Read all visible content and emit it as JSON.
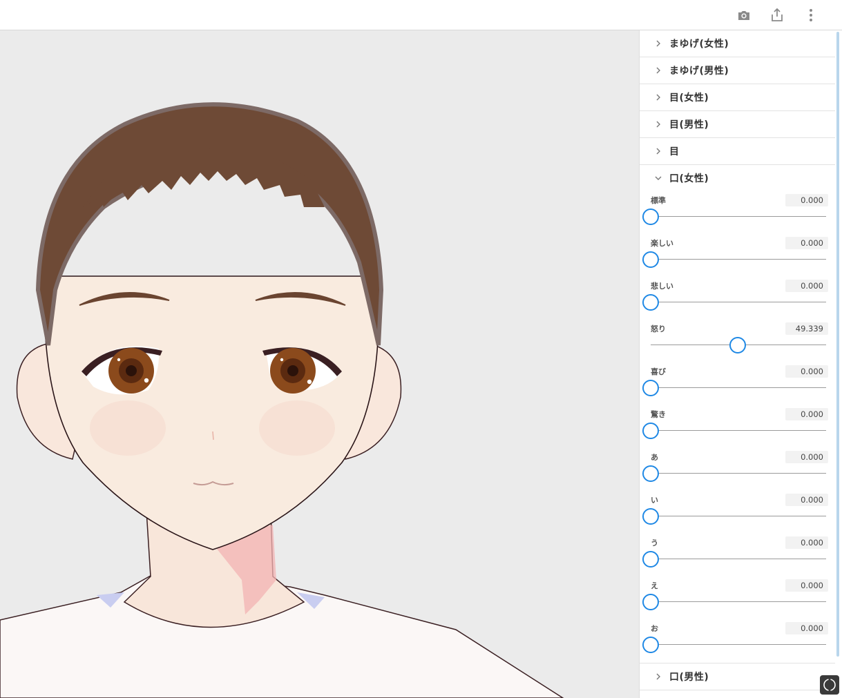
{
  "toolbar": {
    "icons": [
      "camera-icon",
      "share-icon",
      "more-vertical-icon"
    ]
  },
  "panel": {
    "sections_before": [
      {
        "label": "まゆげ(女性)",
        "expanded": false
      },
      {
        "label": "まゆげ(男性)",
        "expanded": false
      },
      {
        "label": "目(女性)",
        "expanded": false
      },
      {
        "label": "目(男性)",
        "expanded": false
      },
      {
        "label": "目",
        "expanded": false
      }
    ],
    "open_section": {
      "label": "口(女性)",
      "expanded": true,
      "sliders": [
        {
          "name": "標準",
          "value": "0.000",
          "level": 0.0
        },
        {
          "name": "楽しい",
          "value": "0.000",
          "level": 0.0
        },
        {
          "name": "悲しい",
          "value": "0.000",
          "level": 0.0
        },
        {
          "name": "怒り",
          "value": "49.339",
          "level": 0.49339
        },
        {
          "name": "喜び",
          "value": "0.000",
          "level": 0.0
        },
        {
          "name": "驚き",
          "value": "0.000",
          "level": 0.0
        },
        {
          "name": "あ",
          "value": "0.000",
          "level": 0.0
        },
        {
          "name": "い",
          "value": "0.000",
          "level": 0.0
        },
        {
          "name": "う",
          "value": "0.000",
          "level": 0.0
        },
        {
          "name": "え",
          "value": "0.000",
          "level": 0.0
        },
        {
          "name": "お",
          "value": "0.000",
          "level": 0.0
        }
      ]
    },
    "sections_after": [
      {
        "label": "口(男性)",
        "expanded": false
      }
    ]
  },
  "colors": {
    "accent": "#1e88e5",
    "viewport_bg": "#ebebeb",
    "hair": "#6e4a36",
    "skin": "#f9ebdf",
    "iris": "#8b4a1c"
  }
}
